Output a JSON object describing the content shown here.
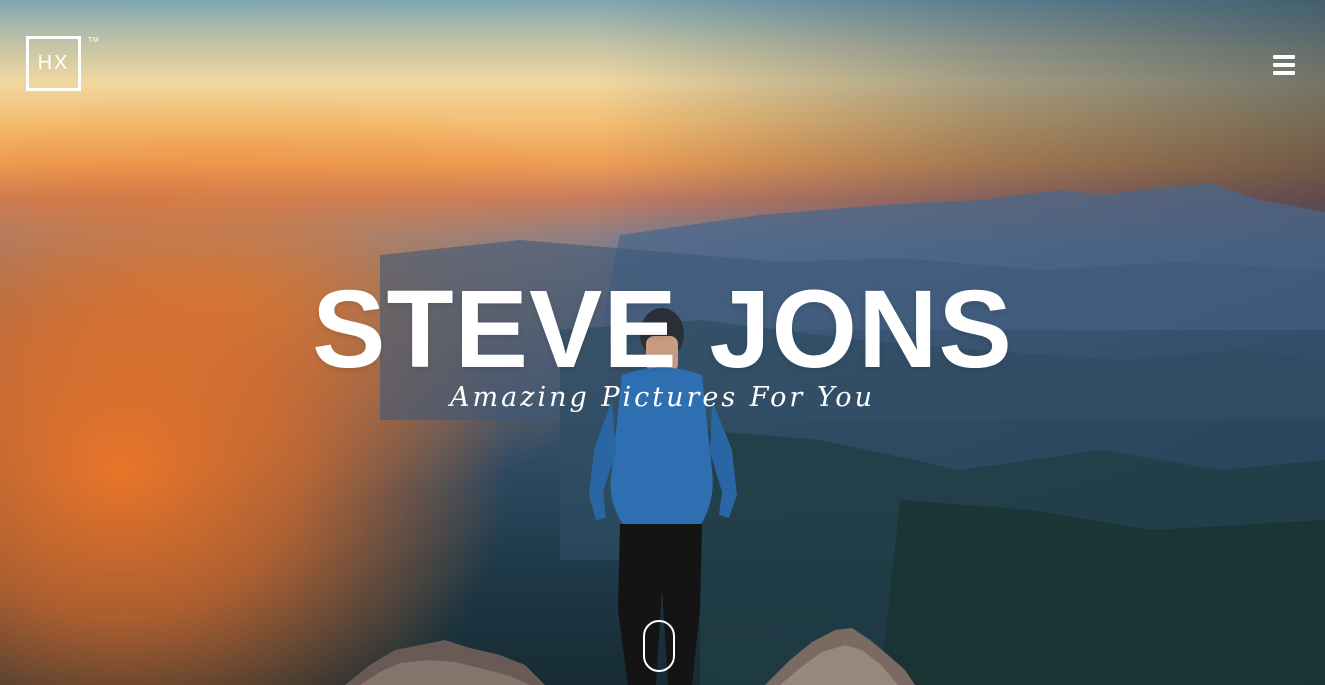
{
  "brand": {
    "logo_text": "HX",
    "trademark": "TM"
  },
  "header": {
    "menu_icon": "hamburger-menu-icon"
  },
  "hero": {
    "title": "STEVE JONS",
    "subtitle": "Amazing Pictures For You",
    "scroll_icon": "scroll-mouse-icon"
  },
  "colors": {
    "text": "#ffffff",
    "sky_warm": "#f4be72",
    "fog_orange": "#f27626",
    "valley_blue": "#2d4a62"
  }
}
